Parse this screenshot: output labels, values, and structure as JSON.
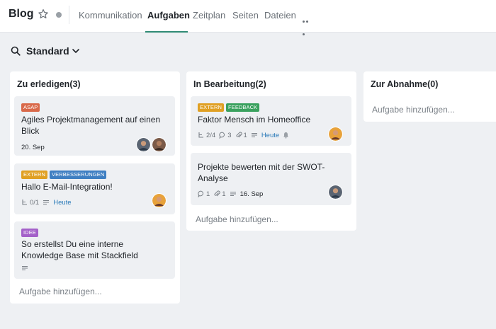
{
  "header": {
    "title": "Blog",
    "tabs": [
      {
        "label": "Kommunikation",
        "active": false
      },
      {
        "label": "Aufgaben",
        "active": true
      },
      {
        "label": "Zeitplan",
        "active": false
      },
      {
        "label": "Seiten",
        "active": false
      },
      {
        "label": "Dateien",
        "active": false
      }
    ],
    "accent_color": "#2f8a74",
    "icons": [
      "star-icon",
      "status-dot-icon",
      "more-icon"
    ]
  },
  "view": {
    "label": "Standard",
    "icons": [
      "search-icon",
      "chevron-down-icon"
    ]
  },
  "tag_colors": {
    "ASAP": "#d9694a",
    "EXTERN": "#e0a024",
    "FEEDBACK": "#3aa15e",
    "VERBESSERUNGEN": "#3f7fc2",
    "IDEE": "#a461c9"
  },
  "columns": [
    {
      "title": "Zu erledigen(3)",
      "add_label": "Aufgabe hinzufügen...",
      "cards": [
        {
          "tags": [
            "ASAP"
          ],
          "title": "Agiles Projektmanagement auf einen Blick",
          "due": "20. Sep",
          "avatars": [
            "avatar-1",
            "avatar-2"
          ]
        },
        {
          "tags": [
            "EXTERN",
            "VERBESSERUNGEN"
          ],
          "title": "Hallo E-Mail-Integration!",
          "subtasks": "0/1",
          "due": "Heute",
          "avatars": [
            "avatar-3"
          ]
        },
        {
          "tags": [
            "IDEE"
          ],
          "title": "So erstellst Du eine interne Knowledge Base mit Stackfield",
          "avatars": []
        }
      ]
    },
    {
      "title": "In Bearbeitung(2)",
      "add_label": "Aufgabe hinzufügen...",
      "cards": [
        {
          "tags": [
            "EXTERN",
            "FEEDBACK"
          ],
          "title": "Faktor Mensch im Homeoffice",
          "subtasks": "2/4",
          "comments": "3",
          "attachments": "1",
          "due": "Heute",
          "avatars": [
            "avatar-3"
          ]
        },
        {
          "tags": [],
          "title": "Projekte bewerten mit der SWOT-Analyse",
          "comments": "1",
          "attachments": "1",
          "due": "16. Sep",
          "avatars": [
            "avatar-1"
          ]
        }
      ]
    },
    {
      "title": "Zur Abnahme(0)",
      "add_label": "Aufgabe hinzufügen...",
      "cards": []
    }
  ]
}
